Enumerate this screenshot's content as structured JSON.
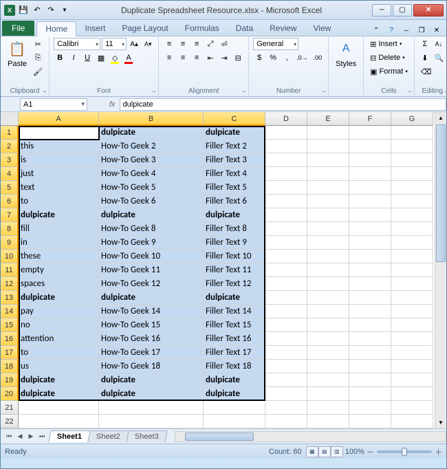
{
  "window": {
    "title": "Duplicate Spreadsheet Resource.xlsx - Microsoft Excel"
  },
  "ribbon": {
    "file_label": "File",
    "tabs": [
      "Home",
      "Insert",
      "Page Layout",
      "Formulas",
      "Data",
      "Review",
      "View"
    ],
    "active_tab": 0,
    "groups": {
      "clipboard": {
        "label": "Clipboard",
        "paste": "Paste"
      },
      "font": {
        "label": "Font",
        "font_name": "Calibri",
        "font_size": "11"
      },
      "alignment": {
        "label": "Alignment"
      },
      "number": {
        "label": "Number",
        "format": "General"
      },
      "styles": {
        "label": "",
        "button": "Styles"
      },
      "cells": {
        "label": "Cells",
        "insert": "Insert",
        "delete": "Delete",
        "format": "Format"
      },
      "editing": {
        "label": "Editing"
      }
    }
  },
  "namebox": {
    "value": "A1"
  },
  "formula": {
    "value": "dulpicate"
  },
  "columns": [
    "A",
    "B",
    "C",
    "D",
    "E",
    "F",
    "G"
  ],
  "selected_cols": [
    "A",
    "B",
    "C"
  ],
  "row_count": 22,
  "selected_rows_max": 20,
  "cells": {
    "data": [
      {
        "a": "dulpicate",
        "b": "dulpicate",
        "c": "dulpicate",
        "bold": true
      },
      {
        "a": "this",
        "b": "How-To Geek  2",
        "c": "Filler Text 2"
      },
      {
        "a": "is",
        "b": "How-To Geek  3",
        "c": "Filler Text 3"
      },
      {
        "a": "just",
        "b": "How-To Geek  4",
        "c": "Filler Text 4"
      },
      {
        "a": "text",
        "b": "How-To Geek  5",
        "c": "Filler Text 5"
      },
      {
        "a": "to",
        "b": "How-To Geek  6",
        "c": "Filler Text 6"
      },
      {
        "a": "dulpicate",
        "b": "dulpicate",
        "c": "dulpicate",
        "bold": true
      },
      {
        "a": "fill",
        "b": "How-To Geek  8",
        "c": "Filler Text 8"
      },
      {
        "a": "in",
        "b": "How-To Geek  9",
        "c": "Filler Text 9"
      },
      {
        "a": "these",
        "b": "How-To Geek  10",
        "c": "Filler Text 10"
      },
      {
        "a": "empty",
        "b": "How-To Geek  11",
        "c": "Filler Text 11"
      },
      {
        "a": "spaces",
        "b": "How-To Geek  12",
        "c": "Filler Text 12"
      },
      {
        "a": "dulpicate",
        "b": "dulpicate",
        "c": "dulpicate",
        "bold": true
      },
      {
        "a": "pay",
        "b": "How-To Geek  14",
        "c": "Filler Text 14"
      },
      {
        "a": "no",
        "b": "How-To Geek  15",
        "c": "Filler Text 15"
      },
      {
        "a": "attention",
        "b": "How-To Geek  16",
        "c": "Filler Text 16"
      },
      {
        "a": "to",
        "b": "How-To Geek  17",
        "c": "Filler Text 17"
      },
      {
        "a": "us",
        "b": "How-To Geek  18",
        "c": "Filler Text 18"
      },
      {
        "a": "dulpicate",
        "b": "dulpicate",
        "c": "dulpicate",
        "bold": true
      },
      {
        "a": "dulpicate",
        "b": "dulpicate",
        "c": "dulpicate",
        "bold": true
      }
    ]
  },
  "sheets": {
    "tabs": [
      "Sheet1",
      "Sheet2",
      "Sheet3"
    ],
    "active": 0
  },
  "status": {
    "ready": "Ready",
    "count_label": "Count:",
    "count_value": "60",
    "zoom": "100%"
  }
}
